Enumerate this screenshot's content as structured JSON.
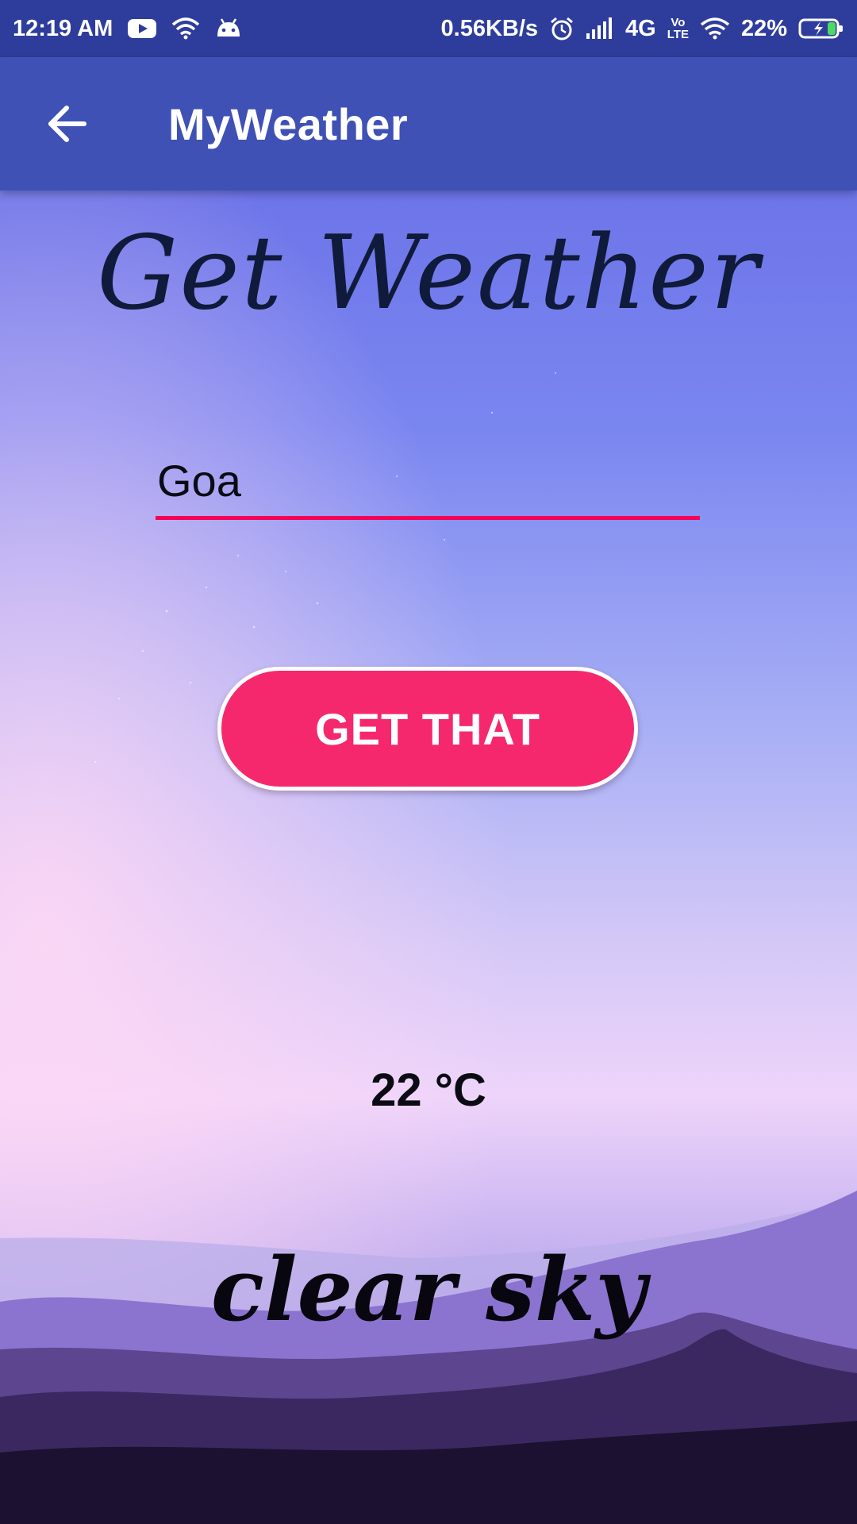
{
  "status_bar": {
    "time": "12:19 AM",
    "net_speed": "0.56KB/s",
    "network": "4G",
    "volte_top": "Vo",
    "volte_bottom": "LTE",
    "battery": "22%",
    "icons": [
      "youtube-icon",
      "wifi-icon",
      "android-icon",
      "alarm-icon",
      "signal-icon",
      "wifi-icon",
      "battery-charging-icon"
    ]
  },
  "app_bar": {
    "title": "MyWeather",
    "back_icon": "back-arrow-icon"
  },
  "main": {
    "heading": "Get Weather",
    "city_value": "Goa",
    "button_label": "GET THAT",
    "temperature": "22 °C",
    "description": "clear sky"
  },
  "colors": {
    "status_bar": "#2e3d9c",
    "app_bar": "#3f51b5",
    "accent": "#f50057",
    "button": "#f5286e"
  }
}
